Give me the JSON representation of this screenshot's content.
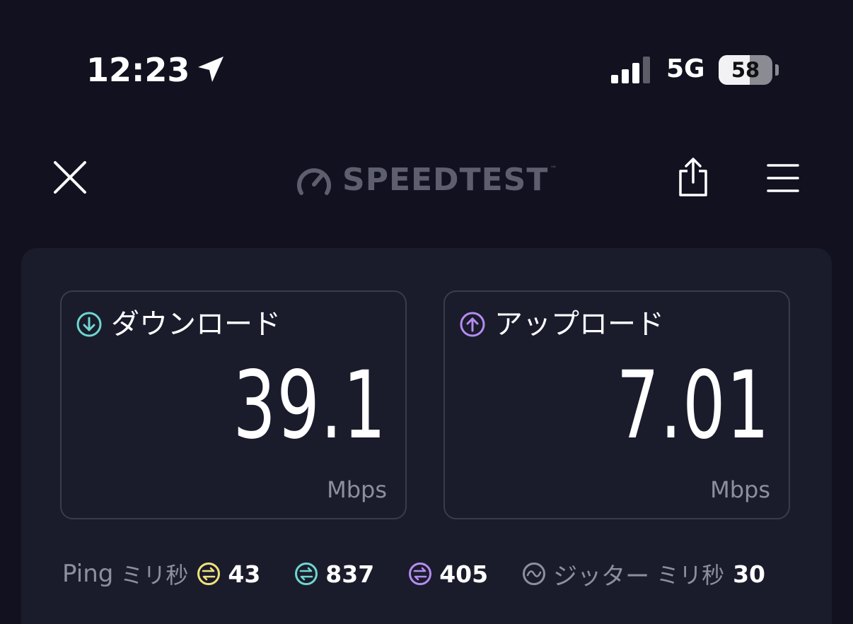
{
  "status_bar": {
    "time": "12:23",
    "network": "5G",
    "battery_percent": 58,
    "battery_label": "58",
    "location_icon": "location-arrow-icon",
    "signal_icon": "cellular-signal-icon"
  },
  "nav": {
    "logo_text": "SPEEDTEST",
    "logo_tm": "™",
    "close_icon": "close-icon",
    "share_icon": "share-icon",
    "menu_icon": "menu-icon"
  },
  "download": {
    "label": "ダウンロード",
    "value": "39.1",
    "unit": "Mbps",
    "icon": "download-arrow-icon",
    "color": "#6fd6d0"
  },
  "upload": {
    "label": "アップロード",
    "value": "7.01",
    "unit": "Mbps",
    "icon": "upload-arrow-icon",
    "color": "#b58cf0"
  },
  "ping": {
    "label": "Ping",
    "unit": "ミリ秒",
    "idle_value": "43",
    "idle_color": "#f2e27a",
    "download_value": "837",
    "download_color": "#6fd6d0",
    "upload_value": "405",
    "upload_color": "#b58cf0",
    "jitter_label": "ジッター",
    "jitter_unit": "ミリ秒",
    "jitter_value": "30"
  },
  "colors": {
    "background": "#111120",
    "panel": "#1a1c2c",
    "card_border": "#3a3c4c",
    "muted_text": "#8e8f9c"
  }
}
